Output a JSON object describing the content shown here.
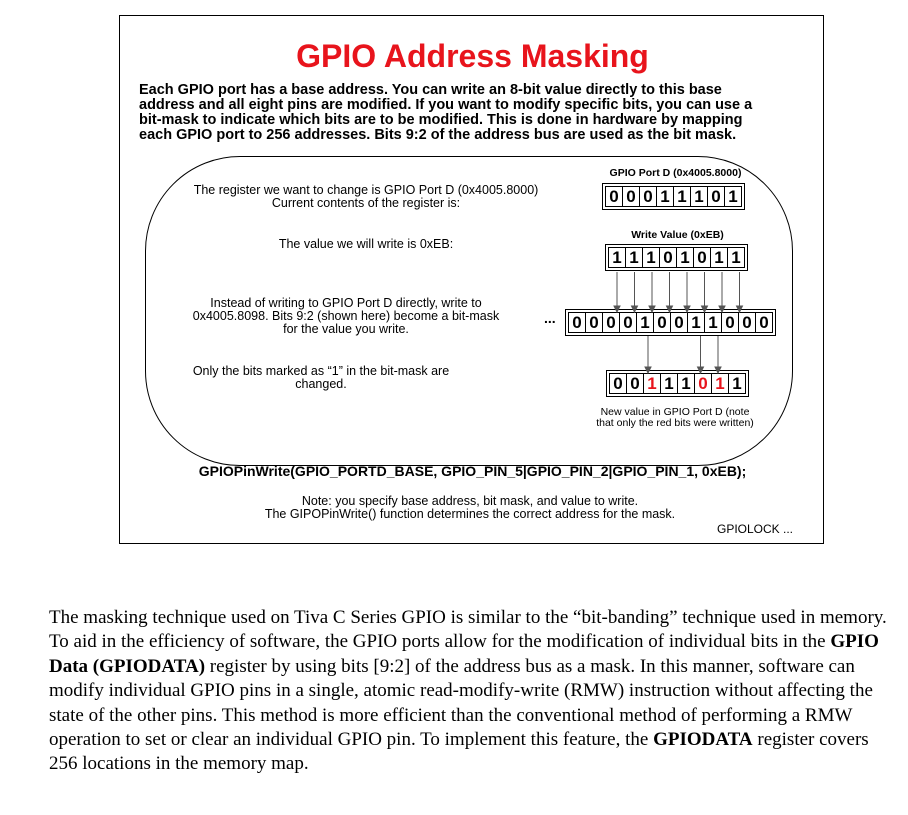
{
  "slide": {
    "title": "GPIO Address Masking",
    "intro_lines": [
      "Each GPIO port has a base address. You can write an 8-bit value directly to this base",
      "address and all eight pins are modified. If you want to modify specific bits, you can use a",
      "bit-mask to indicate which bits are to be modified. This is done in hardware by mapping",
      "each GPIO port to 256 addresses. Bits 9:2 of the address bus are used as the bit mask."
    ],
    "step1_lines": [
      "The register we want to change is GPIO Port D (0x4005.8000)",
      "Current contents of the register is:"
    ],
    "step2_lines": [
      "The value we will write is 0xEB:"
    ],
    "step3_lines": [
      "Instead of writing to GPIO Port D directly, write to",
      "0x4005.8098.  Bits 9:2 (shown here) become a bit-mask",
      "for the value you write."
    ],
    "step4_lines": [
      "Only the bits marked as “1” in the bit-mask are",
      "changed."
    ],
    "portd_label": "GPIO Port D (0x4005.8000)",
    "portd_bits": [
      "0",
      "0",
      "0",
      "1",
      "1",
      "1",
      "0",
      "1"
    ],
    "write_label": "Write Value (0xEB)",
    "write_bits": [
      "1",
      "1",
      "1",
      "0",
      "1",
      "0",
      "1",
      "1"
    ],
    "address_prefix": "...",
    "address_bits": [
      "0",
      "0",
      "0",
      "0",
      "1",
      "0",
      "0",
      "1",
      "1",
      "0",
      "0",
      "0"
    ],
    "result_bits": [
      "0",
      "0",
      "1",
      "1",
      "1",
      "0",
      "1",
      "1"
    ],
    "result_red": [
      false,
      false,
      true,
      false,
      false,
      true,
      true,
      false
    ],
    "result_lines": [
      "New value in GPIO Port D (note",
      "that only the red bits were written)"
    ],
    "code": "GPIOPinWrite(GPIO_PORTD_BASE, GPIO_PIN_5|GPIO_PIN_2|GPIO_PIN_1, 0xEB);",
    "note_lines": [
      "Note: you specify base address, bit mask, and value to write.",
      "The GIPOPinWrite() function determines the correct address for the mask."
    ],
    "footer": "GPIOLOCK ...",
    "colors": {
      "title": "#e8141c",
      "changed_bit": "#e8141c"
    }
  },
  "body_text": {
    "segments": [
      {
        "t": "The masking technique used on Tiva C Series GPIO is similar to the “bit-banding” technique used in memory. To aid in the efficiency of software, the GPIO ports allow for the modification of individual bits in the ",
        "b": false
      },
      {
        "t": "GPIO Data (GPIODATA)",
        "b": true
      },
      {
        "t": " register by using bits [9:2] of the address bus as a mask. In this manner, software can modify individual GPIO pins in a single, atomic read-modify-write (RMW) instruction without affecting the state of the other pins. This method is more efficient than the conventional method of performing a RMW operation to set or clear an individual GPIO pin. To implement this feature, the ",
        "b": false
      },
      {
        "t": "GPIODATA",
        "b": true
      },
      {
        "t": " register covers 256 locations in the memory map.",
        "b": false
      }
    ]
  }
}
